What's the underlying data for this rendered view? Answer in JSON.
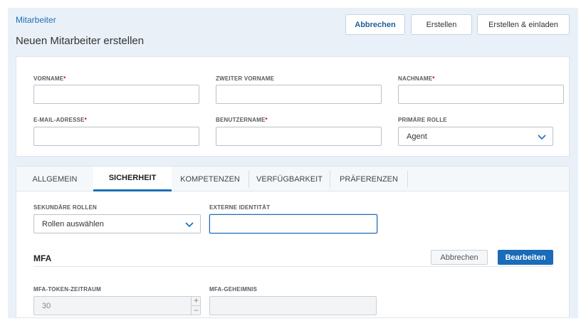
{
  "header": {
    "breadcrumb": "Mitarbeiter",
    "title": "Neuen Mitarbeiter erstellen",
    "buttons": {
      "cancel": "Abbrechen",
      "create": "Erstellen",
      "create_invite": "Erstellen & einladen"
    }
  },
  "form": {
    "first_name": {
      "label": "VORNAME",
      "required_mark": "*",
      "value": ""
    },
    "middle_name": {
      "label": "ZWEITER VORNAME",
      "value": ""
    },
    "last_name": {
      "label": "NACHNAME",
      "required_mark": "*",
      "value": ""
    },
    "email": {
      "label": "E-MAIL-ADRESSE",
      "required_mark": "*",
      "value": ""
    },
    "username": {
      "label": "BENUTZERNAME",
      "required_mark": "*",
      "value": ""
    },
    "primary_role": {
      "label": "PRIMÄRE ROLLE",
      "value": "Agent"
    }
  },
  "tabs": [
    {
      "label": "ALLGEMEIN",
      "active": false
    },
    {
      "label": "SICHERHEIT",
      "active": true
    },
    {
      "label": "KOMPETENZEN",
      "active": false
    },
    {
      "label": "VERFÜGBARKEIT",
      "active": false
    },
    {
      "label": "PRÄFERENZEN",
      "active": false
    }
  ],
  "security": {
    "secondary_roles": {
      "label": "SEKUNDÄRE ROLLEN",
      "placeholder": "Rollen auswählen"
    },
    "external_identity": {
      "label": "EXTERNE IDENTITÄT",
      "value": ""
    },
    "mfa": {
      "title": "MFA",
      "cancel": "Abbrechen",
      "edit": "Bearbeiten",
      "token_period": {
        "label": "MFA-TOKEN-ZEITRAUM",
        "value": "30",
        "plus": "+",
        "minus": "−"
      },
      "secret": {
        "label": "MFA-GEHEIMNIS",
        "value": ""
      }
    }
  },
  "colors": {
    "accent": "#1a6bb8",
    "required": "#d0021b",
    "page_bg": "#e9f0f8"
  }
}
